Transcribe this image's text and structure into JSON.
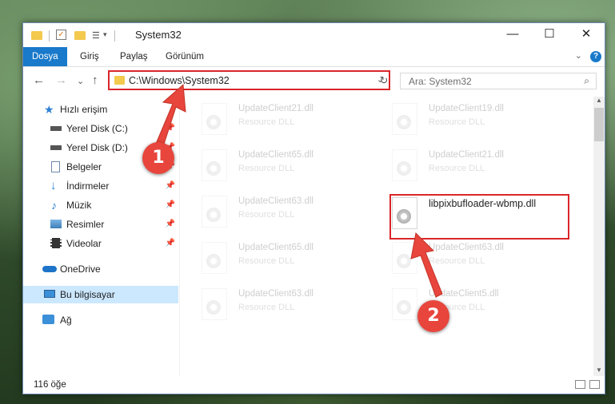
{
  "window": {
    "title": "System32",
    "minimize": "—",
    "maximize": "☐",
    "close": "✕"
  },
  "ribbon": {
    "tabs": [
      "Dosya",
      "Giriş",
      "Paylaş",
      "Görünüm"
    ],
    "help": "?",
    "collapse": "⌄"
  },
  "nav": {
    "back": "←",
    "forward": "→",
    "recent": "⌄",
    "up": "↑",
    "address_path": "C:\\Windows\\System32",
    "address_chevron": "⌄",
    "refresh": "↻",
    "search_placeholder": "Ara: System32",
    "search_icon": "⌕"
  },
  "sidebar": {
    "items": [
      {
        "label": "Hızlı erişim",
        "icon": "star-icon",
        "pinned": false
      },
      {
        "label": "Yerel Disk (C:)",
        "icon": "drive-icon",
        "pinned": true
      },
      {
        "label": "Yerel Disk (D:)",
        "icon": "drive-icon",
        "pinned": true
      },
      {
        "label": "Belgeler",
        "icon": "documents-icon",
        "pinned": true
      },
      {
        "label": "İndirmeler",
        "icon": "download-icon",
        "pinned": true
      },
      {
        "label": "Müzik",
        "icon": "music-icon",
        "pinned": true
      },
      {
        "label": "Resimler",
        "icon": "pictures-icon",
        "pinned": true
      },
      {
        "label": "Videolar",
        "icon": "videos-icon",
        "pinned": true
      },
      {
        "label": "OneDrive",
        "icon": "onedrive-icon",
        "pinned": false
      },
      {
        "label": "Bu bilgisayar",
        "icon": "computer-icon",
        "pinned": false
      },
      {
        "label": "Ağ",
        "icon": "network-icon",
        "pinned": false
      }
    ],
    "pin_glyph": "📌"
  },
  "files": {
    "left": [
      {
        "name": "UpdateClient21.dll",
        "type": "Resource DLL"
      },
      {
        "name": "UpdateClient65.dll",
        "type": "Resource DLL"
      },
      {
        "name": "UpdateClient63.dll",
        "type": "Resource DLL"
      },
      {
        "name": "UpdateClient65.dll",
        "type": "Resource DLL"
      },
      {
        "name": "UpdateClient63.dll",
        "type": "Resource DLL"
      }
    ],
    "right": [
      {
        "name": "UpdateClient19.dll",
        "type": "Resource DLL"
      },
      {
        "name": "UpdateClient21.dll",
        "type": "Resource DLL"
      },
      {
        "name": "libpixbufloader-wbmp.dll",
        "type": ""
      },
      {
        "name": "UpdateClient63.dll",
        "type": "Resource DLL"
      },
      {
        "name": "UpdateClient5.dll",
        "type": "Resource DLL"
      }
    ]
  },
  "status": {
    "count": "116 öğe"
  },
  "annotations": {
    "step1": "1",
    "step2": "2"
  },
  "colors": {
    "accent": "#1979ca",
    "highlight": "#d9262a",
    "annotation": "#e8453c",
    "selected": "#cce8ff"
  }
}
